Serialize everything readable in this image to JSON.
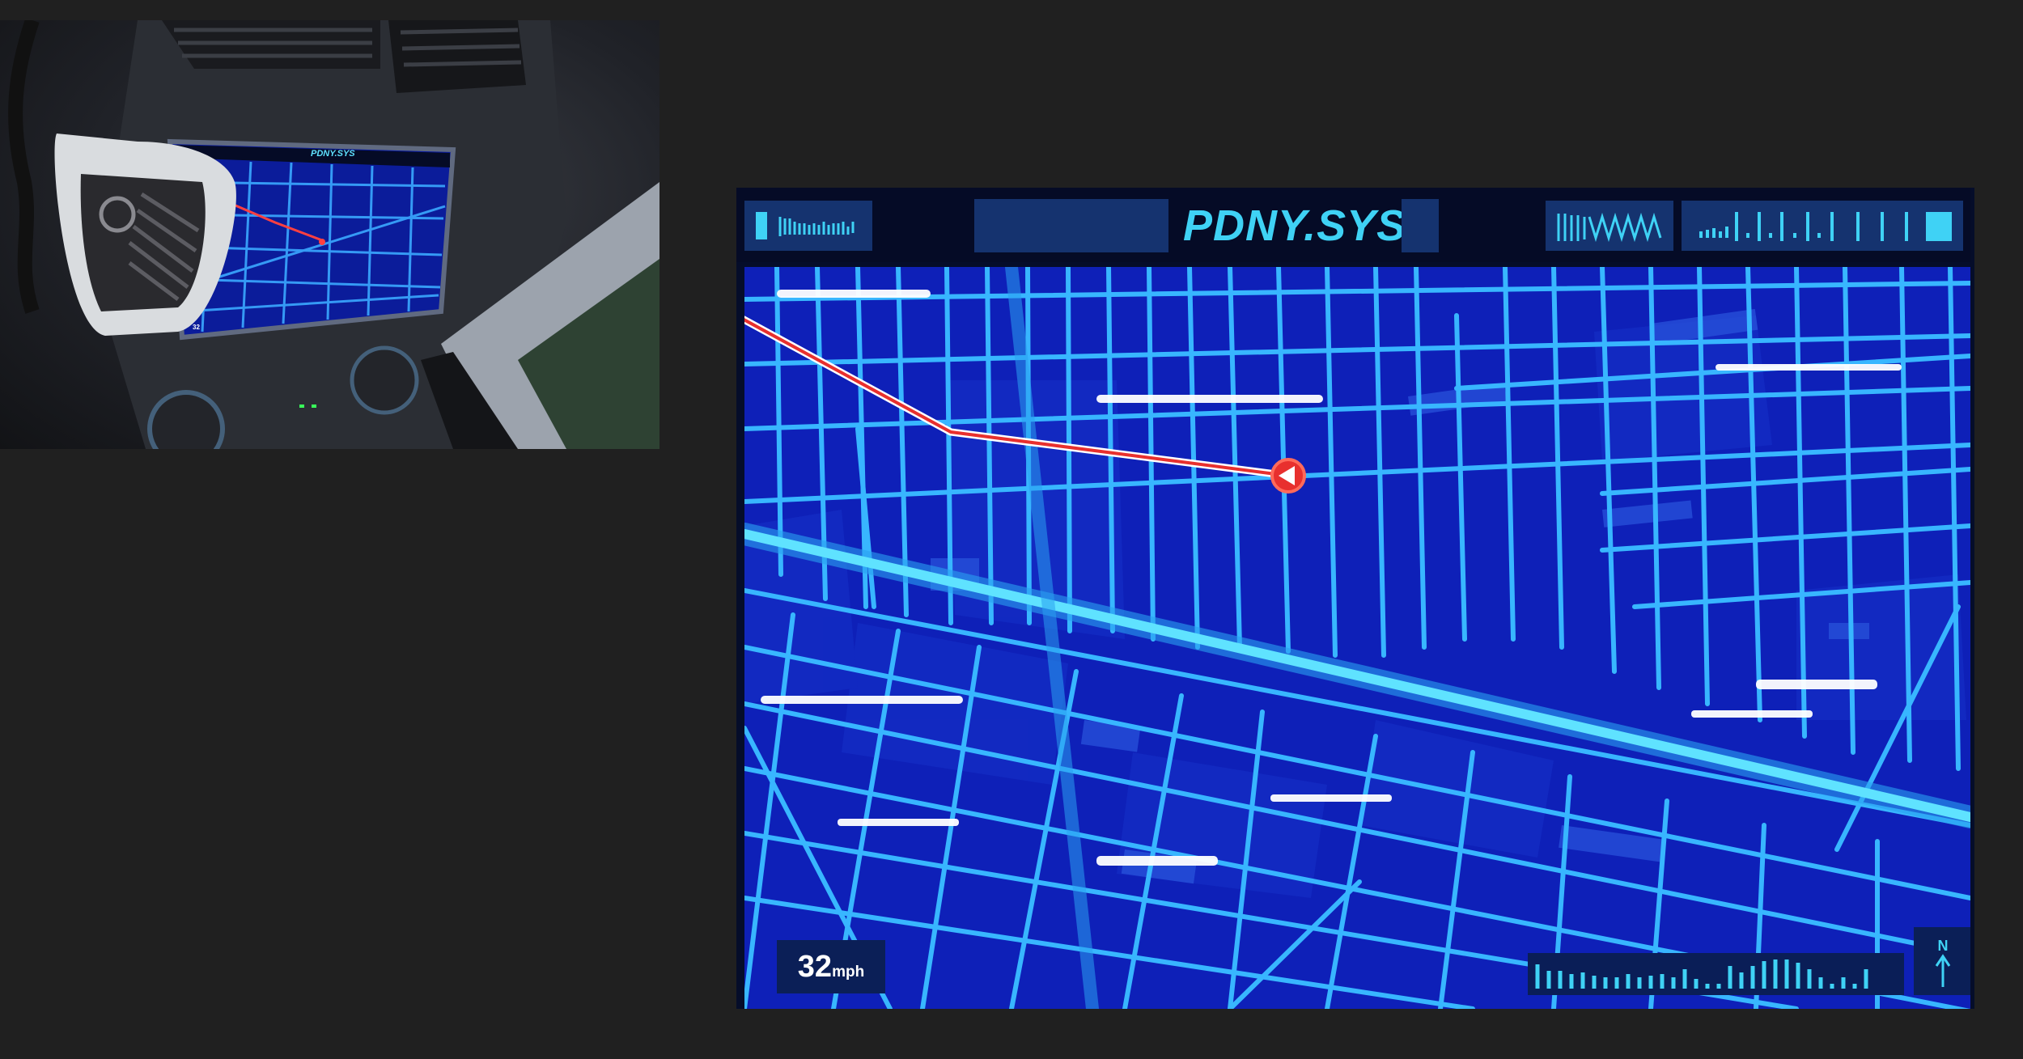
{
  "system": {
    "title": "PDNY.SYS"
  },
  "speed": {
    "value": "32",
    "unit": "mph"
  },
  "compass": {
    "label": "N",
    "icon": "north-arrow-icon"
  },
  "photo": {
    "screen_title": "PDNY.SYS",
    "speed_readout": "32"
  },
  "colors": {
    "background": "#202020",
    "map_base": "#0e20b8",
    "road": "#38b6ff",
    "road_glow": "#5fe2ff",
    "route": "#e8302e",
    "accent": "#3fd2f5",
    "panel": "#15336f"
  },
  "icons": {
    "position_marker": "navigation-arrow-icon",
    "route": "route-line"
  }
}
